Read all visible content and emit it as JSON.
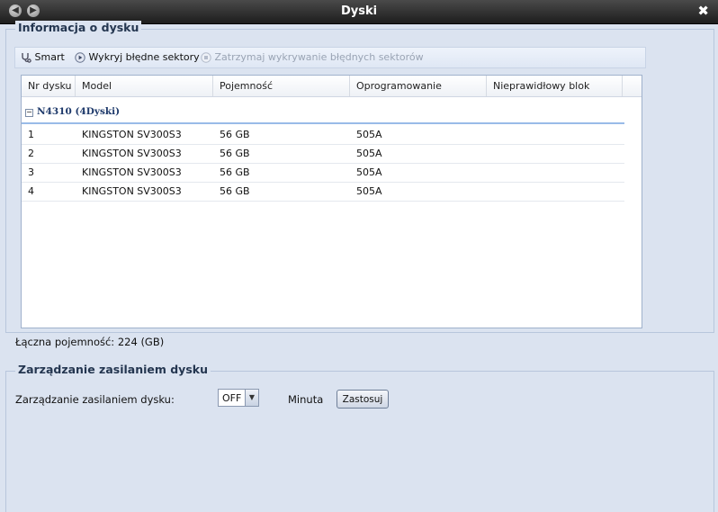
{
  "window": {
    "title": "Dyski",
    "back_icon": "back-arrow-icon",
    "forward_icon": "forward-arrow-icon",
    "close_icon": "close-icon"
  },
  "disk_info": {
    "legend": "Informacja o dysku",
    "toolbar": {
      "smart": "Smart",
      "detect_bad_sectors": "Wykryj błędne sektory",
      "stop_detecting": "Zatrzymaj wykrywanie błędnych sektorów"
    },
    "columns": [
      "Nr dysku",
      "Model",
      "Pojemność",
      "Oprogramowanie",
      "Nieprawidłowy blok"
    ],
    "group": "N4310 (4Dyski)",
    "rows": [
      {
        "nr": "1",
        "model": "KINGSTON SV300S3",
        "capacity": "56 GB",
        "firmware": "505A",
        "bad_block": ""
      },
      {
        "nr": "2",
        "model": "KINGSTON SV300S3",
        "capacity": "56 GB",
        "firmware": "505A",
        "bad_block": ""
      },
      {
        "nr": "3",
        "model": "KINGSTON SV300S3",
        "capacity": "56 GB",
        "firmware": "505A",
        "bad_block": ""
      },
      {
        "nr": "4",
        "model": "KINGSTON SV300S3",
        "capacity": "56 GB",
        "firmware": "505A",
        "bad_block": ""
      }
    ],
    "total_capacity": "Łączna pojemność: 224 (GB)"
  },
  "power": {
    "legend": "Zarządzanie zasilaniem dysku",
    "label": "Zarządzanie zasilaniem dysku:",
    "selected_value": "OFF",
    "unit": "Minuta",
    "apply_button": "Zastosuj"
  }
}
